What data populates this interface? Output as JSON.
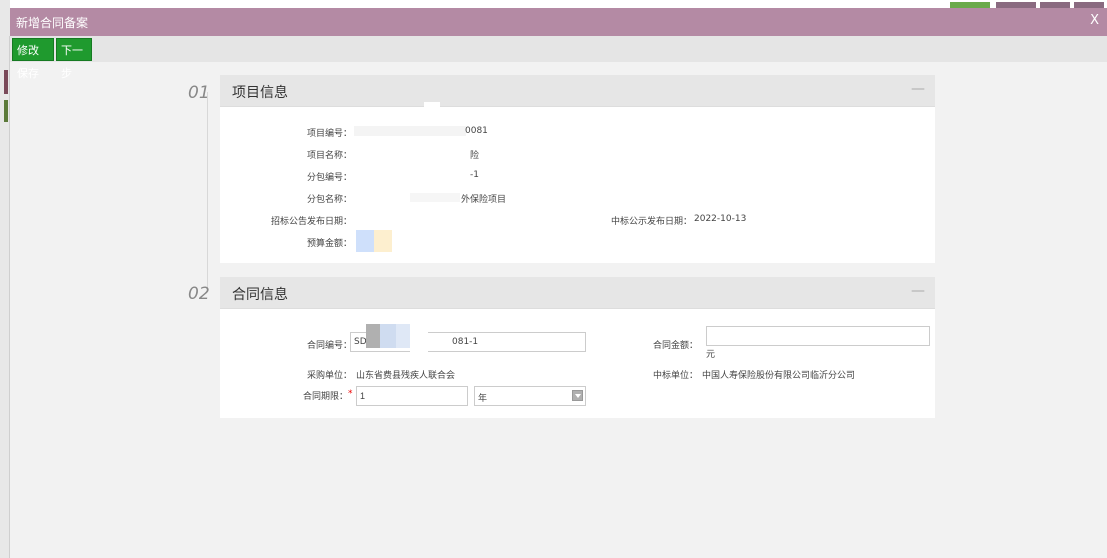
{
  "dialog": {
    "title": "新增合同备案",
    "close_label": "X"
  },
  "toolbar": {
    "save_label": "修改保存",
    "next_label": "下一步"
  },
  "section1": {
    "step": "01",
    "heading": "项目信息",
    "collapse": "—",
    "fields": {
      "project_no_label": "项目编号：",
      "project_no_value": "0081",
      "project_name_label": "项目名称：",
      "project_name_value": "险",
      "package_no_label": "分包编号：",
      "package_no_value": "-1",
      "package_name_label": "分包名称：",
      "package_name_value": "外保险项目",
      "tender_date_label": "招标公告发布日期：",
      "tender_date_value": "",
      "award_date_label": "中标公示发布日期：",
      "award_date_value": "2022-10-13",
      "budget_label": "预算金额："
    }
  },
  "section2": {
    "step": "02",
    "heading": "合同信息",
    "collapse": "—",
    "fields": {
      "contract_no_label": "合同编号：",
      "contract_no_prefix": "SD",
      "contract_no_suffix": "081-1",
      "contract_amount_label": "合同金额：",
      "contract_amount_value": "",
      "currency_unit": "元",
      "purchaser_label": "采购单位：",
      "purchaser_value": "山东省费县残疾人联合会",
      "winner_label": "中标单位：",
      "winner_value": "中国人寿保险股份有限公司临沂分公司",
      "term_label": "合同期限：",
      "required_mark": "*",
      "term_value": "1",
      "term_unit": "年"
    }
  }
}
